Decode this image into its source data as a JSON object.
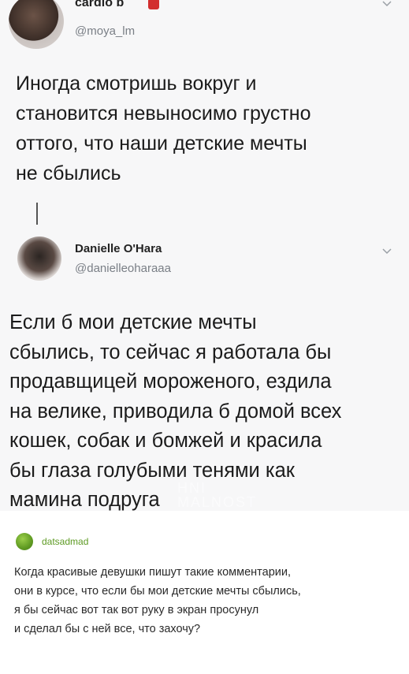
{
  "tweet1": {
    "name": "cardio b",
    "handle": "@moya_lm",
    "text": "Иногда смотришь вокруг и\nстановится невыносимо грустно\nоттого, что наши детские мечты\nне сбылись"
  },
  "tweet2": {
    "name": "Danielle O'Hara",
    "handle": "@danielleoharaaa",
    "text": "Если б мои детские мечты\nсбылись, то сейчас я работала бы\nпродавщицей мороженого, ездила\nна велике, приводила б домой всех\nкошек, собак и бомжей и красила\nбы глаза голубыми тенями как\nмамина подруга"
  },
  "watermark": "HNI\nMALNOST",
  "tumblr": {
    "username": "datsadmad",
    "comment": "Когда красивые девушки пишут такие комментарии,\nони в курсе, что если бы мои детские мечты сбылись,\nя бы сейчас вот так вот руку в экран просунул\nи сделал бы с ней все, что захочу?"
  },
  "icons": {
    "badge": "verified-red-icon",
    "chevron": "chevron-down-icon",
    "avatar_color": "#5f9a22"
  }
}
